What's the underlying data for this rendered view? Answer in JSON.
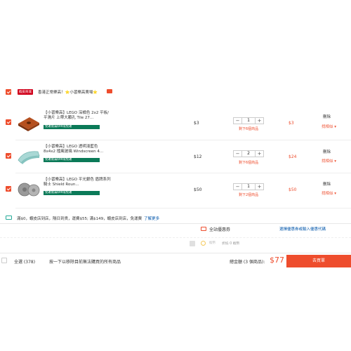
{
  "shop": {
    "badge": "蝦皮商城",
    "name": "香港正常樂高！⭐️小習樂高賣場⭐️"
  },
  "items": [
    {
      "title": "【小習樂高】LEGO 深橘色 2x2 平板/平滑片 上帶大顆孔 Tile 27...",
      "promo": "免運需滿$99或免運",
      "unit_price": "$3",
      "qty": "1",
      "stock": "剩下6個商品",
      "subtotal": "$3",
      "delete": "刪除",
      "similar": "找相似"
    },
    {
      "title": "【小習樂高】LEGO 透明淺藍色 8x4x2 擋風玻璃 Windscreen 4...",
      "promo": "免運需滿$99或免運",
      "unit_price": "$12",
      "qty": "2",
      "stock": "剩下6個商品",
      "subtotal": "$24",
      "delete": "刪除",
      "similar": "找相似"
    },
    {
      "title": "【小習樂高】LEGO 平光銀色 盾牌系列 騎士 Shield Roun...",
      "promo": "免運需滿$99或免運",
      "unit_price": "$50",
      "qty": "1",
      "stock": "剩下2個商品",
      "subtotal": "$50",
      "delete": "刪除",
      "similar": "找相似"
    }
  ],
  "qty_controls": {
    "minus": "−",
    "plus": "+"
  },
  "shipping": {
    "text": "滿$0，蝦皮店到店，隔日到貨，運費$55; 滿$149，蝦皮店到店，免運費",
    "learn_more": "了解更多"
  },
  "voucher": {
    "label": "全站優惠券",
    "link": "選擇優惠券或輸入優惠代碼"
  },
  "coins": {
    "label": "蝦幣",
    "discount": "折抵 0 蝦幣"
  },
  "footer": {
    "select_all": "全選 (378)",
    "remove_invalid": "按一下以移除目前無法購買的所有商品",
    "total_label": "總金額 (3 個商品):",
    "total_amount": "$77",
    "checkout": "去買單"
  },
  "colors": {
    "accent": "#ee4d2d",
    "promo_green": "#0b7a58",
    "mall_red": "#d0011b"
  }
}
